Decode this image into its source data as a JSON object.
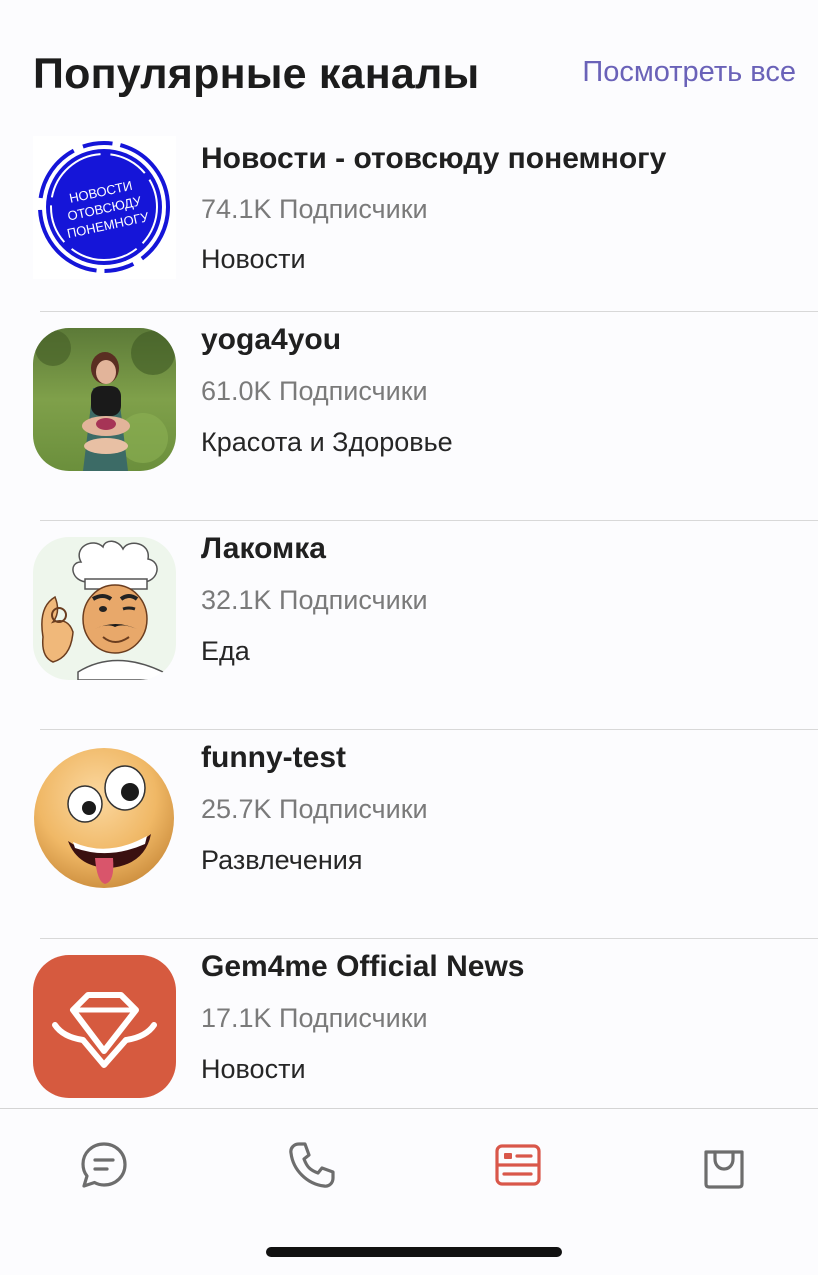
{
  "header": {
    "title": "Популярные каналы",
    "see_all": "Посмотреть все"
  },
  "channels": [
    {
      "name": "Новости - отовсюду понемногу",
      "subscribers": "74.1K Подписчики",
      "category": "Новости",
      "avatar": "news-badge-icon",
      "avatar_text": [
        "НОВОСТИ",
        "ОТОВСЮДУ",
        "ПОНЕМНОГУ"
      ]
    },
    {
      "name": "yoga4you",
      "subscribers": "61.0K Подписчики",
      "category": "Красота и Здоровье",
      "avatar": "yoga-photo"
    },
    {
      "name": "Лакомка",
      "subscribers": "32.1K Подписчики",
      "category": "Еда",
      "avatar": "chef-illustration"
    },
    {
      "name": "funny-test",
      "subscribers": "25.7K Подписчики",
      "category": "Развлечения",
      "avatar": "tongue-emoji"
    },
    {
      "name": "Gem4me Official News",
      "subscribers": "17.1K Подписчики",
      "category": "Новости",
      "avatar": "gem-logo-icon"
    }
  ],
  "bottom_nav": [
    {
      "icon": "chat-icon",
      "active": false
    },
    {
      "icon": "phone-icon",
      "active": false
    },
    {
      "icon": "channels-icon",
      "active": true
    },
    {
      "icon": "shopping-bag-icon",
      "active": false
    }
  ],
  "colors": {
    "accent": "#6a62b8",
    "nav_active": "#d9574a",
    "nav_inactive": "#6d6d6d",
    "news_badge": "#1a1ad6",
    "gem_brand": "#d65a3f"
  }
}
